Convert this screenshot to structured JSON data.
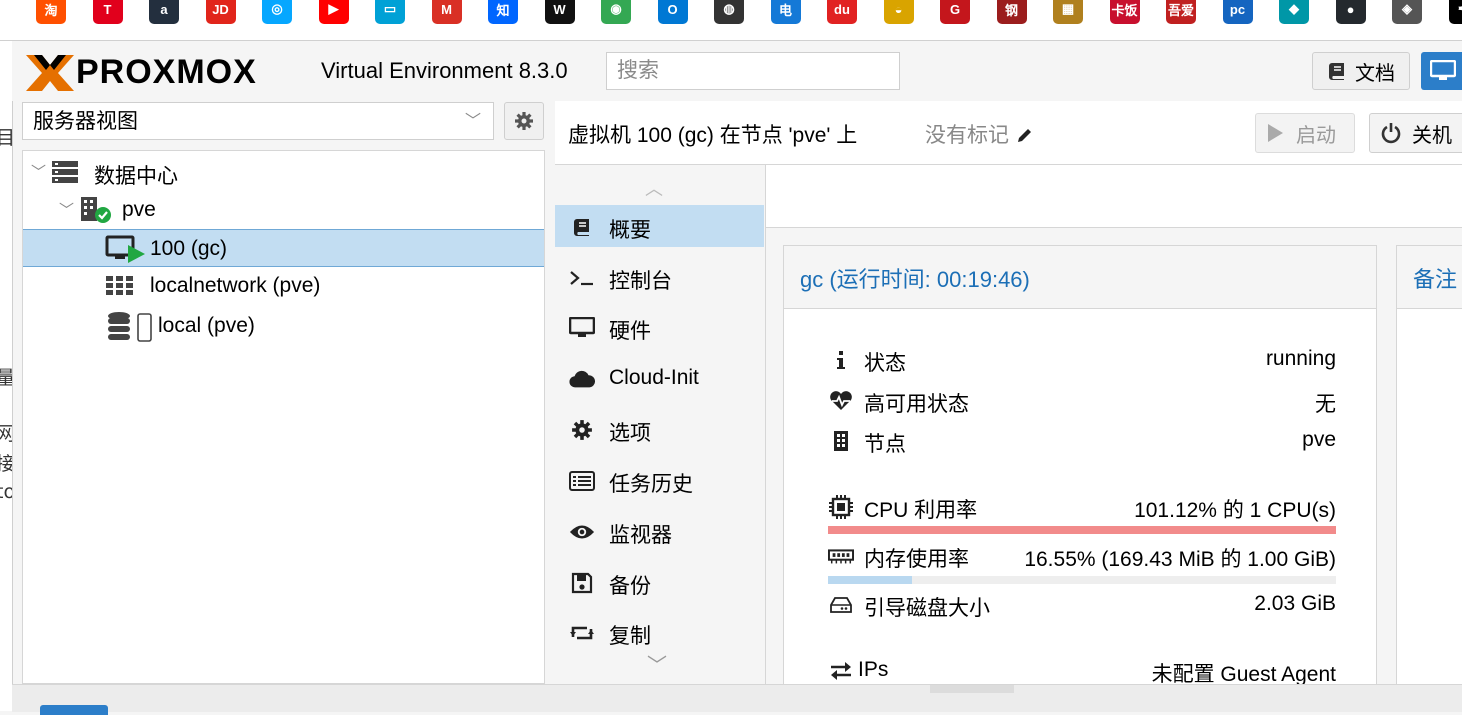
{
  "colors": {
    "brand_orange": "#e57000",
    "selection": "#c2ddf2",
    "link_blue": "#1c6fb6",
    "cpu_bar": "#f28b8b",
    "mem_bar": "#b9d8f0",
    "ok_green": "#21a742"
  },
  "bookmarks": [
    {
      "icon": "taobao-icon",
      "glyph": "淘",
      "color": "#ff5000"
    },
    {
      "icon": "tmall-icon",
      "glyph": "T",
      "color": "#e1001c"
    },
    {
      "icon": "amazon-icon",
      "glyph": "a",
      "color": "#232f3e"
    },
    {
      "icon": "jd-icon",
      "glyph": "JD",
      "color": "#e1251b"
    },
    {
      "icon": "baidu-netdisk-icon",
      "glyph": "◎",
      "color": "#06a7ff"
    },
    {
      "icon": "youtube-icon",
      "glyph": "▶",
      "color": "#ff0000"
    },
    {
      "icon": "bilibili-icon",
      "glyph": "▭",
      "color": "#00a1d6"
    },
    {
      "icon": "gmail-icon",
      "glyph": "M",
      "color": "#d93025"
    },
    {
      "icon": "zhihu-icon",
      "glyph": "知",
      "color": "#0066ff"
    },
    {
      "icon": "wikipedia-icon",
      "glyph": "W",
      "color": "#111111"
    },
    {
      "icon": "chrome-icon",
      "glyph": "◉",
      "color": "#34a853"
    },
    {
      "icon": "outlook-icon",
      "glyph": "O",
      "color": "#0078d4"
    },
    {
      "icon": "globe-icon",
      "glyph": "◍",
      "color": "#333333"
    },
    {
      "icon": "telecom-icon",
      "glyph": "电",
      "color": "#1479d7"
    },
    {
      "icon": "map-pin-icon",
      "glyph": "du",
      "color": "#e12222"
    },
    {
      "icon": "duck-icon",
      "glyph": "◒",
      "color": "#d9a400"
    },
    {
      "icon": "g-icon",
      "glyph": "G",
      "color": "#c4161c"
    },
    {
      "icon": "seal-icon",
      "glyph": "钢",
      "color": "#9b1d1d"
    },
    {
      "icon": "pattern-icon",
      "glyph": "▦",
      "color": "#b0801e"
    },
    {
      "icon": "kafan-icon",
      "glyph": "卡饭",
      "color": "#c8102e"
    },
    {
      "icon": "52pojie-icon",
      "glyph": "吾爱",
      "color": "#c02020"
    },
    {
      "icon": "pc-icon",
      "glyph": "pc",
      "color": "#1565c0"
    },
    {
      "icon": "diamond-icon",
      "glyph": "◆",
      "color": "#0097a7"
    },
    {
      "icon": "github-icon",
      "glyph": "●",
      "color": "#24292e"
    },
    {
      "icon": "stack-icon",
      "glyph": "◈",
      "color": "#555555"
    },
    {
      "icon": "pen-icon",
      "glyph": "✒",
      "color": "#000000"
    }
  ],
  "left_stub": [
    "目",
    "量",
    "网",
    "接",
    "to"
  ],
  "header": {
    "brand": "PROXMOX",
    "product": "Virtual Environment 8.3.0",
    "search_placeholder": "搜索",
    "docs_label": "文档"
  },
  "tree": {
    "view_label": "服务器视图",
    "items": [
      {
        "label": "数据中心",
        "icon": "datacenter-icon"
      },
      {
        "label": "pve",
        "icon": "node-online-icon"
      },
      {
        "label": "100 (gc)",
        "icon": "vm-running-icon",
        "selected": true
      },
      {
        "label": "localnetwork (pve)",
        "icon": "sdn-zone-icon"
      },
      {
        "label": "local (pve)",
        "icon": "storage-icon"
      }
    ]
  },
  "toolbar": {
    "title": "虚拟机 100 (gc) 在节点 'pve' 上",
    "tags_label": "没有标记",
    "start_label": "启动",
    "shutdown_label": "关机"
  },
  "nav": [
    {
      "label": "概要",
      "icon": "book-icon",
      "active": true
    },
    {
      "label": "控制台",
      "icon": "terminal-icon"
    },
    {
      "label": "硬件",
      "icon": "monitor-icon"
    },
    {
      "label": "Cloud-Init",
      "icon": "cloud-icon"
    },
    {
      "label": "选项",
      "icon": "gear-icon"
    },
    {
      "label": "任务历史",
      "icon": "list-icon"
    },
    {
      "label": "监视器",
      "icon": "eye-icon"
    },
    {
      "label": "备份",
      "icon": "floppy-icon"
    },
    {
      "label": "复制",
      "icon": "retweet-icon"
    }
  ],
  "status": {
    "title": "gc (运行时间: 00:19:46)",
    "rows": [
      {
        "key": "状态",
        "value": "running",
        "icon": "info-icon"
      },
      {
        "key": "高可用状态",
        "value": "无",
        "icon": "heartbeat-icon"
      },
      {
        "key": "节点",
        "value": "pve",
        "icon": "building-icon"
      },
      {
        "key": "CPU 利用率",
        "value": "101.12% 的 1 CPU(s)",
        "icon": "cpu-icon"
      },
      {
        "key": "内存使用率",
        "value": "16.55% (169.43 MiB 的 1.00 GiB)",
        "icon": "memory-icon"
      },
      {
        "key": "引导磁盘大小",
        "value": "2.03 GiB",
        "icon": "hdd-icon"
      },
      {
        "key": "IPs",
        "value": "未配置 Guest Agent",
        "icon": "exchange-icon"
      }
    ],
    "cpu_usage_fraction": 1.0,
    "memory_usage_fraction": 0.1655
  },
  "notes": {
    "title": "备注"
  }
}
